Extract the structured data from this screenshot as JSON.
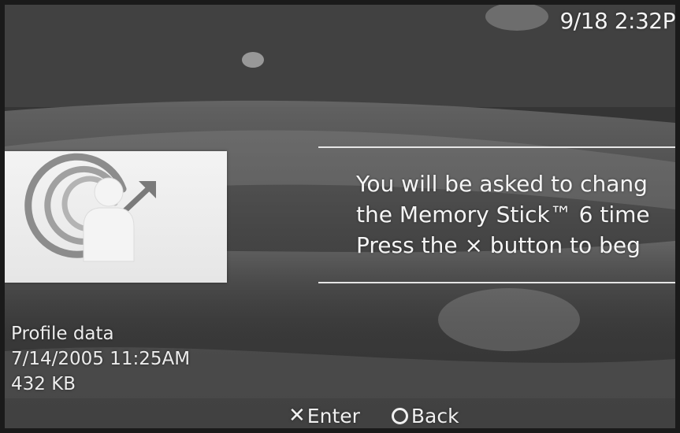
{
  "status_bar": {
    "clock": "9/18 2:32P"
  },
  "dialog": {
    "icon": "profile-user-arrow-icon",
    "message_lines": [
      "You will be asked to chang",
      "the Memory Stick™ 6 time",
      "Press the × button to beg"
    ]
  },
  "save_info": {
    "title": "Profile data",
    "date": "7/14/2005 11:25AM",
    "size": "432 KB"
  },
  "footer": {
    "enter_glyph": "✕",
    "enter_label": "Enter",
    "back_label": "Back"
  },
  "colors": {
    "text": "#f2f2f2",
    "background": "#3a3a3a",
    "card": "#efefef"
  }
}
